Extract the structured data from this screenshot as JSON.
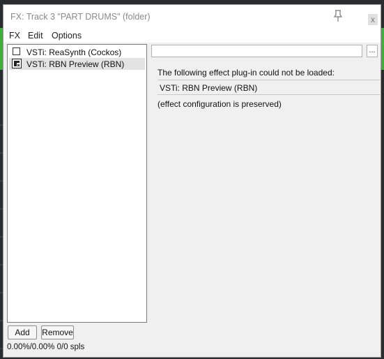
{
  "window": {
    "title": "FX: Track 3 \"PART DRUMS\" (folder)",
    "close_label": "x"
  },
  "menu": {
    "items": [
      "FX",
      "Edit",
      "Options"
    ]
  },
  "fx_list": {
    "items": [
      {
        "label": "VSTi: ReaSynth (Cockos)",
        "enabled": false,
        "selected": false
      },
      {
        "label": "VSTi: RBN Preview (RBN)",
        "enabled": true,
        "selected": true
      }
    ]
  },
  "plugin_panel": {
    "name_value": "",
    "browse_label": "...",
    "error_message": "The following effect plug-in could not be loaded:",
    "error_plugin": "VSTi: RBN Preview (RBN)",
    "error_note": "(effect configuration is preserved)"
  },
  "buttons": {
    "add": "Add",
    "remove": "Remove"
  },
  "status": {
    "cpu": "0.00%/0.00% 0/0 spls"
  },
  "icons": {
    "pin": "pin-icon",
    "close": "close-icon",
    "plugin_missing": "plugin-missing-icon"
  }
}
